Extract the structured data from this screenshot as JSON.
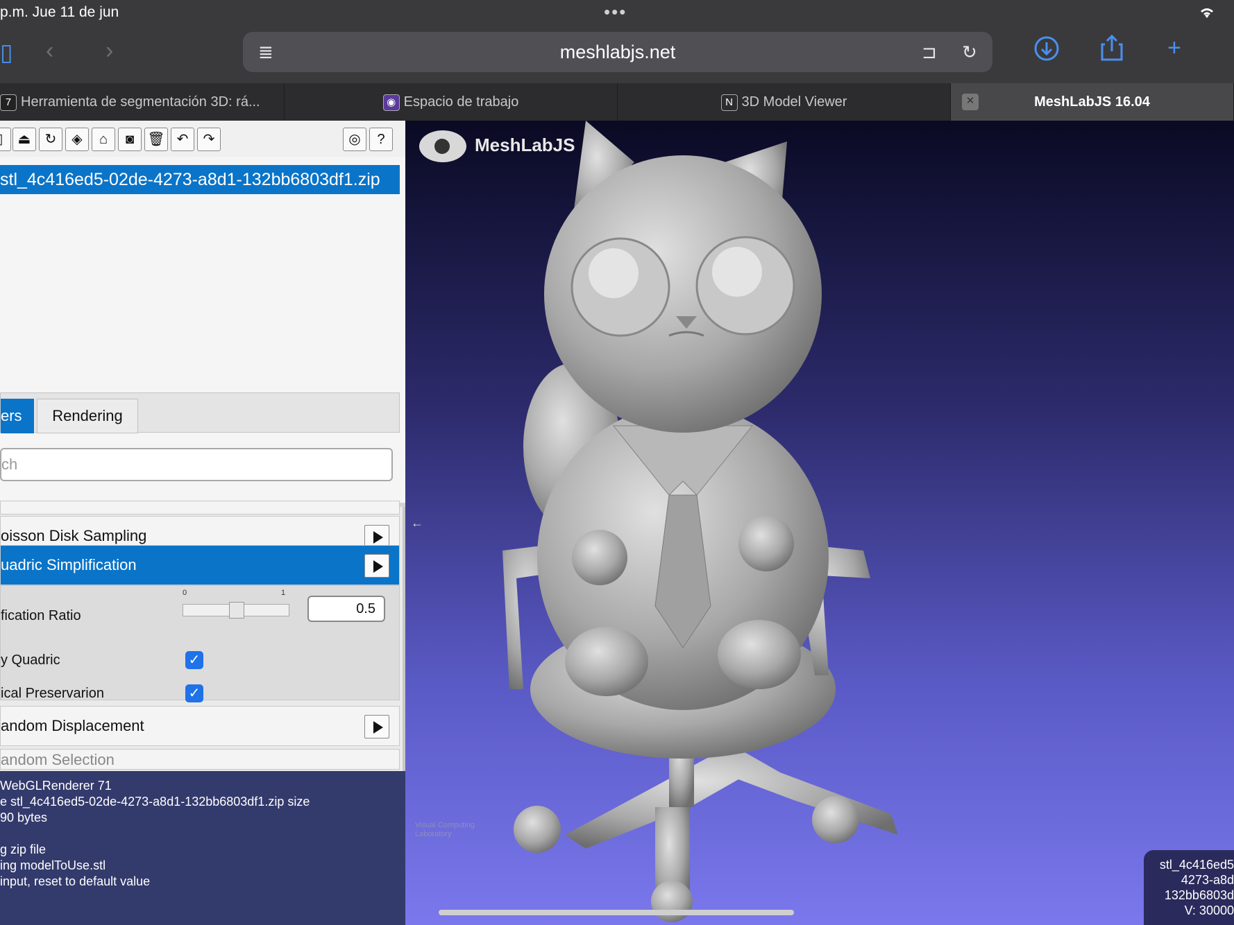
{
  "status": {
    "time": "p.m.   Jue 11 de jun"
  },
  "browser": {
    "url": "meshlabjs.net",
    "tabs": [
      {
        "label": "Herramienta de segmentación 3D: rá..."
      },
      {
        "label": "Espacio de trabajo"
      },
      {
        "label": "3D Model Viewer"
      },
      {
        "label": "MeshLabJS 16.04"
      }
    ]
  },
  "layers": {
    "selected_file": "stl_4c416ed5-02de-4273-a8d1-132bb6803df1.zip"
  },
  "panel_tabs": {
    "filters": "ers",
    "rendering": "Rendering"
  },
  "search": {
    "placeholder": "ch"
  },
  "filters": {
    "poisson": "oisson Disk Sampling",
    "quadric": "uadric Simplification",
    "random_disp": "andom Displacement",
    "random_sel": "andom Selection"
  },
  "params": {
    "ratio_label": "fication Ratio",
    "ratio_value": "0.5",
    "ratio_min": "0",
    "ratio_max": "1",
    "ratio_level": 0.5,
    "quadric_label": "y Quadric",
    "preserv_label": "ical Preservarion"
  },
  "console": {
    "lines": [
      "WebGLRenderer 71",
      "e stl_4c416ed5-02de-4273-a8d1-132bb6803df1.zip size",
      "90 bytes",
      "",
      "g zip file",
      "ing modelToUse.stl",
      "input, reset to default value"
    ]
  },
  "viewport": {
    "brand": "MeshLabJS",
    "info_lines": [
      "stl_4c416ed5",
      "4273-a8d",
      "132bb6803d",
      "V: 30000"
    ],
    "lab_text": "Visual Computing Laboratory"
  },
  "colors": {
    "accent": "#0a74c8",
    "browser_blue": "#4a90f0"
  }
}
